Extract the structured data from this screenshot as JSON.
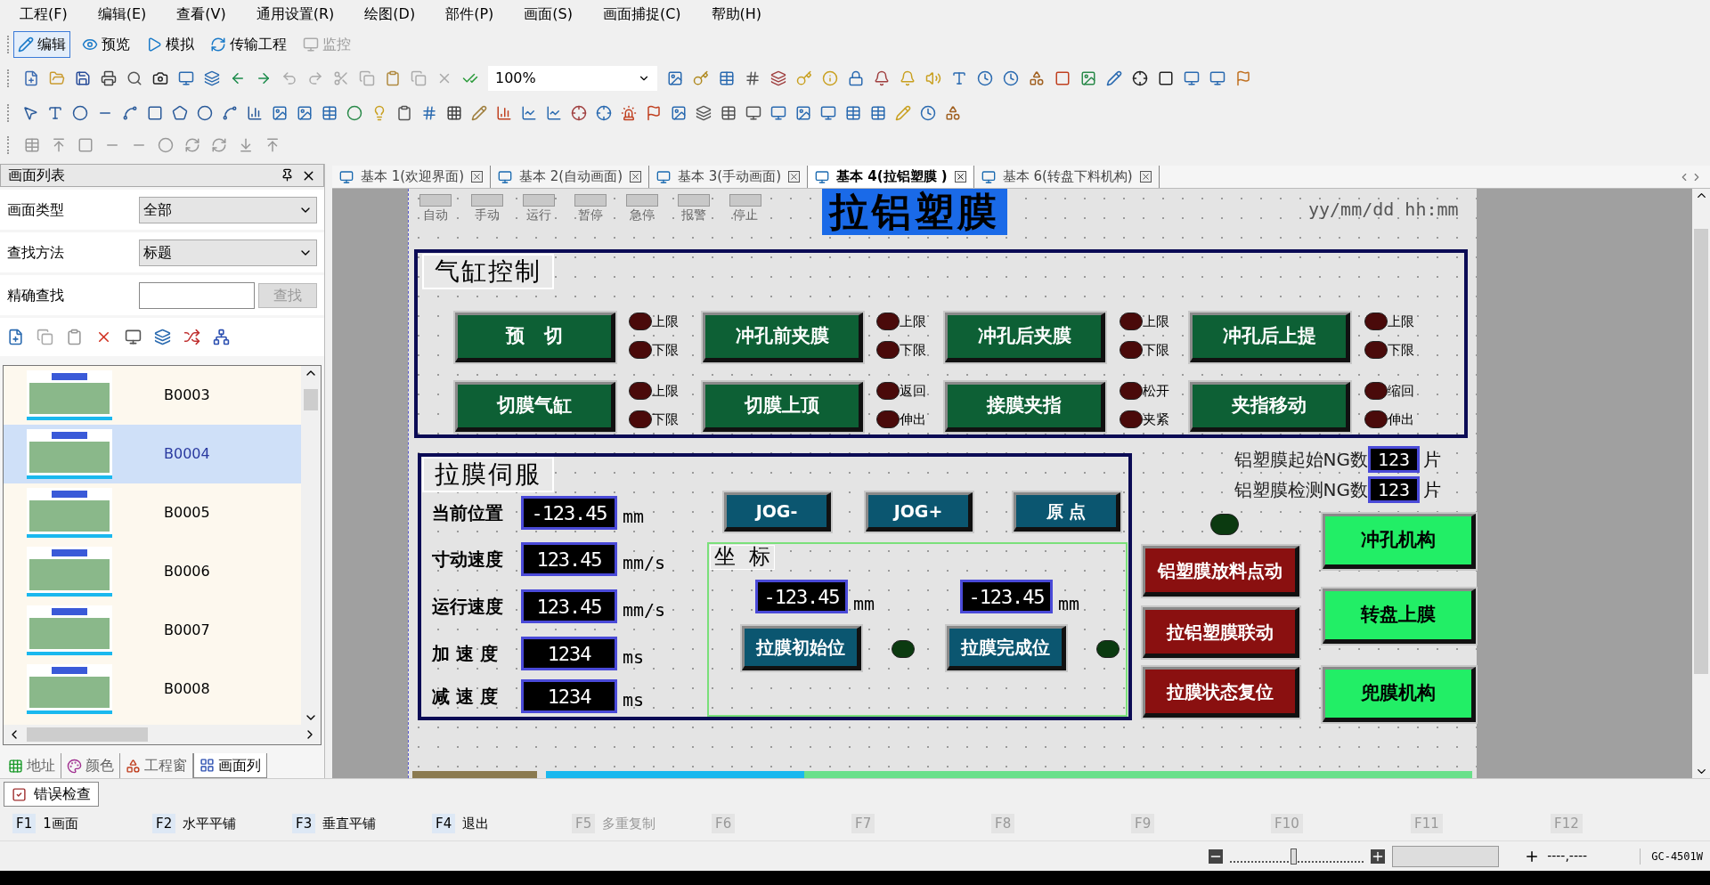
{
  "menu": [
    "工程(F)",
    "编辑(E)",
    "查看(V)",
    "通用设置(R)",
    "绘图(D)",
    "部件(P)",
    "画面(S)",
    "画面捕捉(C)",
    "帮助(H)"
  ],
  "modes": [
    {
      "label": "编辑",
      "selected": true,
      "disabled": false
    },
    {
      "label": "预览",
      "selected": false,
      "disabled": false
    },
    {
      "label": "模拟",
      "selected": false,
      "disabled": false
    },
    {
      "label": "传输工程",
      "selected": false,
      "disabled": false
    },
    {
      "label": "监控",
      "selected": false,
      "disabled": true
    }
  ],
  "zoom": {
    "value": "100%"
  },
  "screen_list": {
    "title": "画面列表",
    "filters": [
      {
        "kind": "select",
        "label": "画面类型",
        "value": "全部"
      },
      {
        "kind": "select",
        "label": "查找方法",
        "value": "标题"
      },
      {
        "kind": "search",
        "label": "精确查找",
        "button": "查找",
        "button_disabled": true
      }
    ],
    "items": [
      {
        "label": "B0003",
        "selected": false
      },
      {
        "label": "B0004",
        "selected": true
      },
      {
        "label": "B0005",
        "selected": false
      },
      {
        "label": "B0006",
        "selected": false
      },
      {
        "label": "B0007",
        "selected": false
      },
      {
        "label": "B0008",
        "selected": false
      }
    ],
    "tabs": [
      {
        "label": "地址",
        "selected": false
      },
      {
        "label": "颜色",
        "selected": false
      },
      {
        "label": "工程窗",
        "selected": false
      },
      {
        "label": "画面列",
        "selected": true
      }
    ]
  },
  "screen_tabs": [
    {
      "label": "基本 1(欢迎界面)",
      "selected": false
    },
    {
      "label": "基本 2(自动画面)",
      "selected": false
    },
    {
      "label": "基本 3(手动画面)",
      "selected": false
    },
    {
      "label": "基本 4(拉铝塑膜 )",
      "selected": true
    },
    {
      "label": "基本 6(转盘下料机构)",
      "selected": false
    }
  ],
  "canvas": {
    "status_lamps": [
      "自动",
      "手动",
      "运行",
      "暂停",
      "急停",
      "报警",
      "停止"
    ],
    "title": "拉铝塑膜",
    "datetime": "yy/mm/dd hh:mm",
    "cylinder_panel": {
      "title": "气缸控制",
      "buttons": [
        {
          "label": "预   切",
          "lamps": [
            "上限",
            "下限"
          ]
        },
        {
          "label": "冲孔前夹膜",
          "lamps": [
            "上限",
            "下限"
          ]
        },
        {
          "label": "冲孔后夹膜",
          "lamps": [
            "上限",
            "下限"
          ]
        },
        {
          "label": "冲孔后上提",
          "lamps": [
            "上限",
            "下限"
          ]
        },
        {
          "label": "切膜气缸",
          "lamps": [
            "上限",
            "下限"
          ]
        },
        {
          "label": "切膜上顶",
          "lamps": [
            "返回",
            "伸出"
          ]
        },
        {
          "label": "接膜夹指",
          "lamps": [
            "松开",
            "夹紧"
          ]
        },
        {
          "label": "夹指移动",
          "lamps": [
            "缩回",
            "伸出"
          ]
        }
      ]
    },
    "servo_panel": {
      "title": "拉膜伺服",
      "rows": [
        {
          "label": "当前位置",
          "value": "-123.45",
          "unit": "mm"
        },
        {
          "label": "寸动速度",
          "value": "123.45",
          "unit": "mm/s"
        },
        {
          "label": "运行速度",
          "value": "123.45",
          "unit": "mm/s"
        },
        {
          "label": "加 速 度",
          "value": "1234",
          "unit": "ms"
        },
        {
          "label": "减 速 度",
          "value": "1234",
          "unit": "ms"
        }
      ],
      "jog_buttons": [
        "JOG-",
        "JOG+",
        "原 点"
      ],
      "coordinates": {
        "title": "坐  标",
        "points": [
          {
            "value": "-123.45",
            "unit": "mm",
            "button": "拉膜初始位"
          },
          {
            "value": "-123.45",
            "unit": "mm",
            "button": "拉膜完成位"
          }
        ]
      }
    },
    "ng_counts": [
      {
        "label": "铝塑膜起始NG数",
        "value": "123",
        "unit": "片"
      },
      {
        "label": "铝塑膜检测NG数",
        "value": "123",
        "unit": "片"
      }
    ],
    "red_buttons": [
      "铝塑膜放料点动",
      "拉铝塑膜联动",
      "拉膜状态复位"
    ],
    "green_buttons": [
      "冲孔机构",
      "转盘上膜",
      "兜膜机构"
    ]
  },
  "error_tab": "错误检查",
  "function_keys": [
    {
      "key": "F1",
      "label": "1画面",
      "disabled": false
    },
    {
      "key": "F2",
      "label": "水平平铺",
      "disabled": false
    },
    {
      "key": "F3",
      "label": "垂直平铺",
      "disabled": false
    },
    {
      "key": "F4",
      "label": "退出",
      "disabled": false
    },
    {
      "key": "F5",
      "label": "多重复制",
      "disabled": true
    },
    {
      "key": "F6",
      "disabled": true
    },
    {
      "key": "F7",
      "disabled": true
    },
    {
      "key": "F8",
      "disabled": true
    },
    {
      "key": "F9",
      "disabled": true
    },
    {
      "key": "F10",
      "disabled": true
    },
    {
      "key": "F11",
      "disabled": true
    },
    {
      "key": "F12",
      "disabled": true
    }
  ],
  "status_bar": {
    "zoom_slider": {
      "level": 0.45
    },
    "coordinates": "----,----",
    "model": "GC-4501W"
  }
}
